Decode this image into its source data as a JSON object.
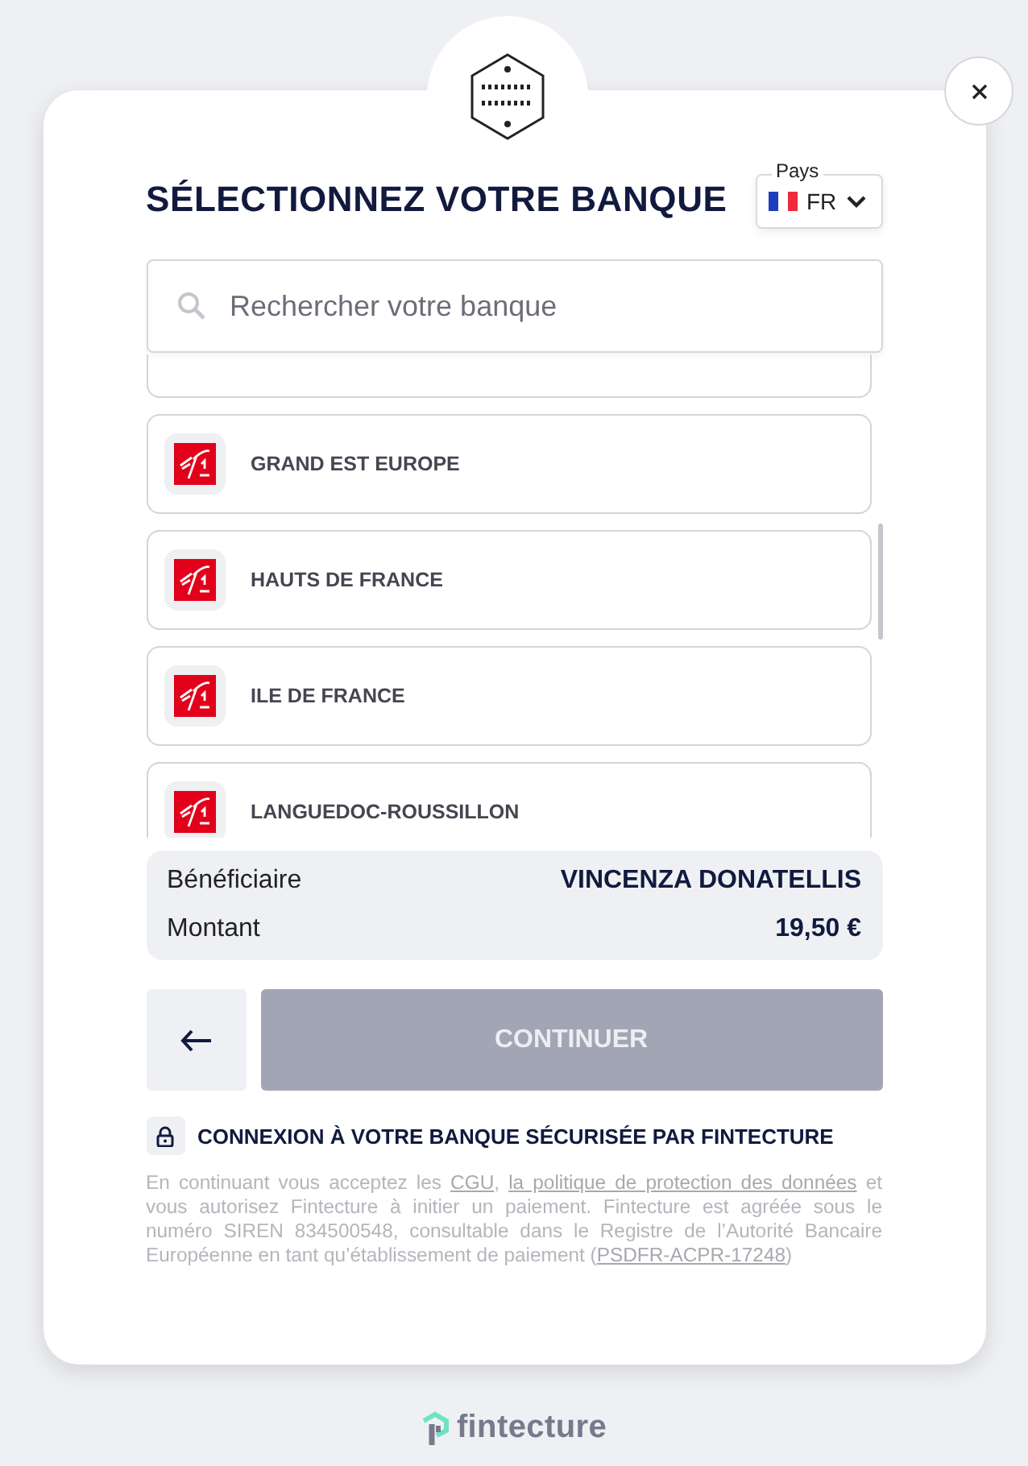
{
  "title": "SÉLECTIONNEZ VOTRE BANQUE",
  "country": {
    "label": "Pays",
    "value": "FR"
  },
  "search": {
    "placeholder": "Rechercher votre banque"
  },
  "banks": [
    {
      "name": "GRAND EST EUROPE"
    },
    {
      "name": "HAUTS DE FRANCE"
    },
    {
      "name": "ILE DE FRANCE"
    },
    {
      "name": "LANGUEDOC-ROUSSILLON"
    }
  ],
  "summary": [
    {
      "label": "Bénéficiaire",
      "value": "VINCENZA DONATELLIS"
    },
    {
      "label": "Montant",
      "value": "19,50 €"
    }
  ],
  "continue": {
    "label": "CONTINUER",
    "disabled": true
  },
  "secure_note": "CONNEXION À VOTRE BANQUE SÉCURISÉE PAR FINTECTURE",
  "legal": [
    {
      "kind": "text",
      "text": "En continuant vous acceptez les "
    },
    {
      "kind": "link",
      "text": "CGU"
    },
    {
      "kind": "text",
      "text": ", "
    },
    {
      "kind": "link",
      "text": "la politique de protection des données"
    },
    {
      "kind": "text",
      "text": " et vous autorisez Fintecture à initier un paiement. Fintecture est agréée sous le numéro SIREN 834500548, consultable dans le Registre de l’Autorité Bancaire Européenne en tant qu’établissement de paiement ("
    },
    {
      "kind": "link",
      "text": "PSDFR-ACPR-17248"
    },
    {
      "kind": "text",
      "text": ")"
    }
  ],
  "footer": {
    "brand": "fintecture"
  }
}
